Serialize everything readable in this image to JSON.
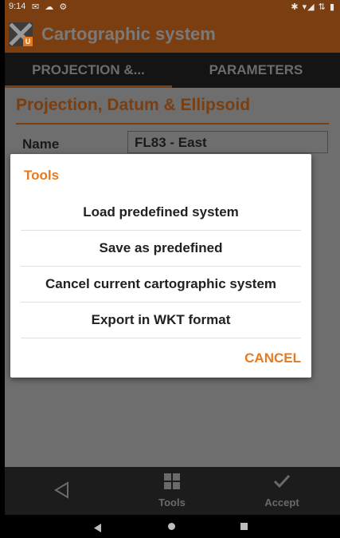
{
  "status_bar": {
    "time": "9:14",
    "left_icons": "✉ ☁ ⚙",
    "right_icons": "✱ ▾◢ ⇅ ▮"
  },
  "app_bar": {
    "logo_icon": "xu-logo-icon",
    "logo_badge": "U",
    "title": "Cartographic system"
  },
  "tabs": [
    {
      "label": "PROJECTION &...",
      "active": true
    },
    {
      "label": "PARAMETERS",
      "active": false
    }
  ],
  "content": {
    "section_title": "Projection, Datum & Ellipsoid",
    "name_label": "Name",
    "name_value": "FL83 - East"
  },
  "dialog": {
    "title": "Tools",
    "items": [
      {
        "label": "Load predefined system"
      },
      {
        "label": "Save as predefined"
      },
      {
        "label": "Cancel current cartographic system"
      },
      {
        "label": "Export in WKT format"
      }
    ],
    "cancel_label": "CANCEL"
  },
  "toolbar": {
    "back_icon": "back-triangle-icon",
    "tools_label": "Tools",
    "tools_icon": "grid-icon",
    "accept_label": "Accept",
    "accept_icon": "checkmark-icon"
  },
  "colors": {
    "accent": "#e8791e",
    "app_bar_dimmed": "#7a3e10",
    "dialog_bg": "#ffffff"
  }
}
